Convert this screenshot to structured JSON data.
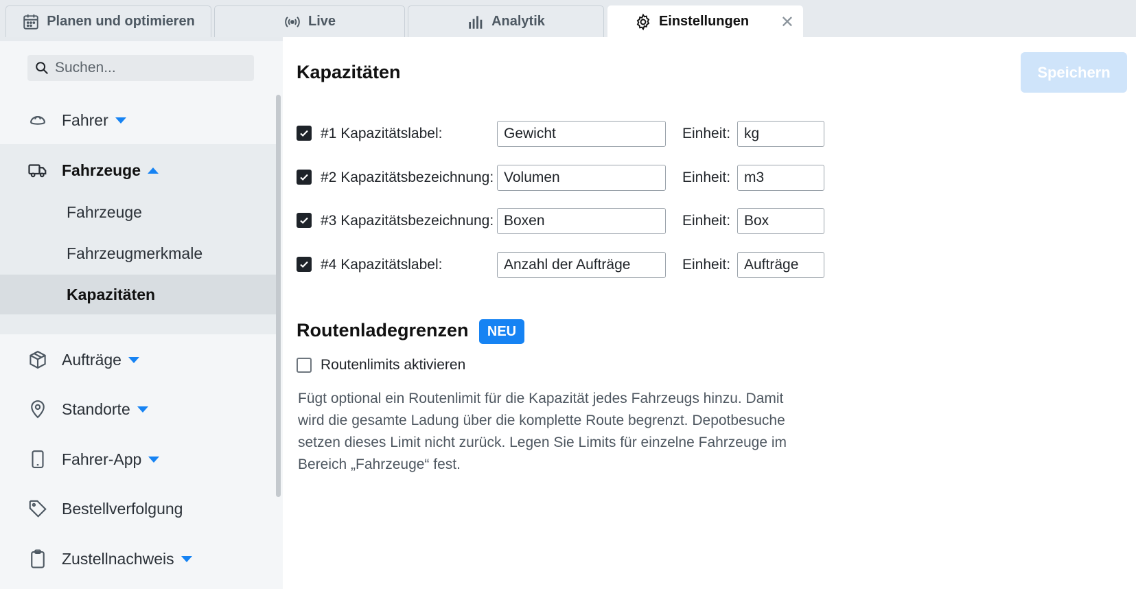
{
  "tabs": [
    {
      "label": "Planen und optimieren",
      "icon": "calendar-icon"
    },
    {
      "label": "Live",
      "icon": "broadcast-icon"
    },
    {
      "label": "Analytik",
      "icon": "bar-chart-icon"
    },
    {
      "label": "Einstellungen",
      "icon": "gear-icon",
      "active": true,
      "close": "✕"
    }
  ],
  "search": {
    "placeholder": "Suchen..."
  },
  "sidebar": {
    "items": [
      {
        "label": "Fahrer",
        "icon": "driver-helmet-icon"
      },
      {
        "label": "Fahrzeuge",
        "icon": "truck-icon"
      },
      {
        "label": "Aufträge",
        "icon": "package-icon"
      },
      {
        "label": "Standorte",
        "icon": "location-pin-icon"
      },
      {
        "label": "Fahrer-App",
        "icon": "phone-icon"
      },
      {
        "label": "Bestellverfolgung",
        "icon": "tag-icon"
      },
      {
        "label": "Zustellnachweis",
        "icon": "clipboard-icon"
      }
    ],
    "subitems": [
      {
        "label": "Fahrzeuge"
      },
      {
        "label": "Fahrzeugmerkmale"
      },
      {
        "label": "Kapazitäten",
        "active": true
      }
    ]
  },
  "main": {
    "title": "Kapazitäten",
    "save_label": "Speichern",
    "capacities": [
      {
        "label": "#1 Kapazitätslabel:",
        "value": "Gewicht",
        "unit_label": "Einheit:",
        "unit": "kg",
        "checked": true
      },
      {
        "label": "#2 Kapazitätsbezeichnung:",
        "value": "Volumen",
        "unit_label": "Einheit:",
        "unit": "m3",
        "checked": true
      },
      {
        "label": "#3 Kapazitätsbezeichnung:",
        "value": "Boxen",
        "unit_label": "Einheit:",
        "unit": "Box",
        "checked": true
      },
      {
        "label": "#4 Kapazitätslabel:",
        "value": "Anzahl der Aufträge",
        "unit_label": "Einheit:",
        "unit": "Aufträge",
        "checked": true
      }
    ],
    "route_limits": {
      "title": "Routenladegrenzen",
      "badge": "NEU",
      "checkbox_label": "Routenlimits aktivieren",
      "checked": false,
      "description": "Fügt optional ein Routenlimit für die Kapazität jedes Fahrzeugs hinzu. Damit wird die gesamte Ladung über die komplette Route begrenzt. Depotbesuche setzen dieses Limit nicht zurück. Legen Sie Limits für einzelne Fahrzeuge im Bereich „Fahrzeuge“ fest."
    }
  },
  "colors": {
    "accent": "#1683f3",
    "save_disabled": "#cfe4fa",
    "sidebar_bg": "#f4f6f8",
    "tabbar_bg": "#e6eaee"
  }
}
